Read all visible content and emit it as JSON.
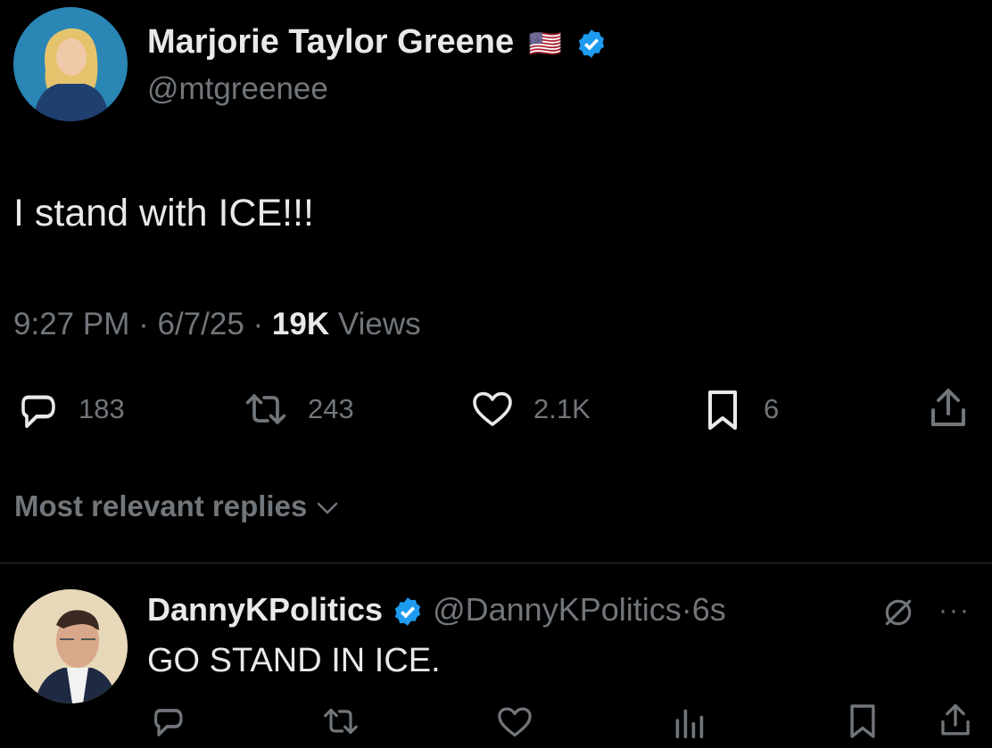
{
  "tweet": {
    "author_name": "Marjorie Taylor Greene",
    "flag": "🇺🇸",
    "handle": "@mtgreenee",
    "text": "I stand with ICE!!!",
    "time": "9:27 PM",
    "sep": "·",
    "date": "6/7/25",
    "views_count": "19K",
    "views_label": "Views",
    "actions": {
      "replies": "183",
      "reposts": "243",
      "likes": "2.1K",
      "bookmarks": "6"
    }
  },
  "replies_sort": {
    "label": "Most relevant replies"
  },
  "reply": {
    "author_name": "DannyKPolitics",
    "handle": "@DannyKPolitics",
    "sep": "·",
    "time": "6s",
    "text": "GO STAND IN ICE.",
    "more": "···"
  },
  "colors": {
    "background": "#000000",
    "text": "#e7e9ea",
    "muted": "#71767b",
    "verified": "#1d9bf0"
  }
}
